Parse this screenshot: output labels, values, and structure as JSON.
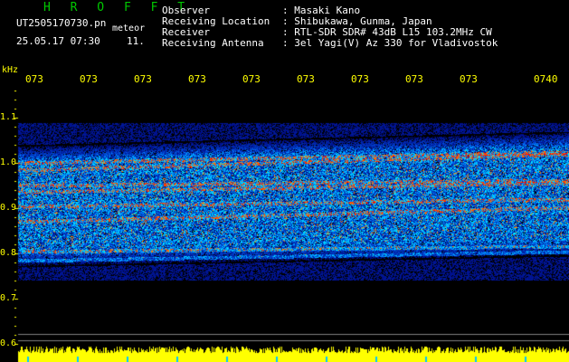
{
  "header": {
    "title": "H R O F F T",
    "filename": "UT2505170730.pn",
    "meteor_label": "meteor",
    "date_time": "25.05.17 07:30",
    "count": "11.",
    "info_rows": [
      {
        "key": "Observer",
        "value": ": Masaki Kano"
      },
      {
        "key": "Receiving Location",
        "value": ": Shibukawa, Gunma, Japan"
      },
      {
        "key": "Receiver",
        "value": ": RTL-SDR SDR# 43dB L15 103.2MHz CW"
      },
      {
        "key": "Receiving Antenna",
        "value": ": 3el Yagi(V) Az 330 for Vladivostok"
      }
    ]
  },
  "chart_data": {
    "type": "heatmap",
    "ylabel": "kHz",
    "y_ticks": [
      "1.1",
      "1.0",
      "0.9",
      "0.8",
      "0.7",
      "0.6"
    ],
    "x_ticks": [
      "073",
      "073",
      "073",
      "073",
      "073",
      "073",
      "073",
      "073",
      "073",
      "0740"
    ],
    "ylim": [
      0.6,
      1.1
    ],
    "colors": {
      "background": "#000000",
      "low": "#0000c8",
      "mid": "#00c8ff",
      "high": "#ff3c00",
      "axis_text": "#ffff00",
      "level_bar": "#ffff00"
    }
  }
}
